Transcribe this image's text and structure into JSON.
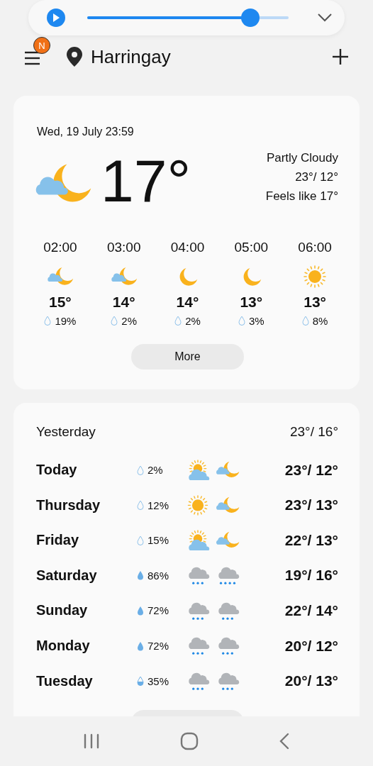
{
  "media_player": {
    "playing": false,
    "level": 0.81
  },
  "header": {
    "menu_badge": "N",
    "location": "Harringay"
  },
  "current": {
    "date": "Wed, 19 July 23:59",
    "icon": {
      "kind": "moon-cloud"
    },
    "temperature": "17°",
    "condition": "Partly Cloudy",
    "high_low": "23°/ 12°",
    "feels_like": "Feels like 17°",
    "hourly": [
      {
        "time": "02:00",
        "icon": {
          "kind": "moon-cloud"
        },
        "temperature": "15°",
        "drop": {
          "kind": "empty"
        },
        "precip": "19%"
      },
      {
        "time": "03:00",
        "icon": {
          "kind": "moon-cloud"
        },
        "temperature": "14°",
        "drop": {
          "kind": "empty"
        },
        "precip": "2%"
      },
      {
        "time": "04:00",
        "icon": {
          "kind": "moon"
        },
        "temperature": "14°",
        "drop": {
          "kind": "empty"
        },
        "precip": "2%"
      },
      {
        "time": "05:00",
        "icon": {
          "kind": "moon"
        },
        "temperature": "13°",
        "drop": {
          "kind": "empty"
        },
        "precip": "3%"
      },
      {
        "time": "06:00",
        "icon": {
          "kind": "sun"
        },
        "temperature": "13°",
        "drop": {
          "kind": "empty"
        },
        "precip": "8%"
      }
    ],
    "more_button": "More"
  },
  "daily": {
    "yesterday": {
      "label": "Yesterday",
      "high_low": "23°/ 16°"
    },
    "days": [
      {
        "day": "Today",
        "drop": {
          "kind": "empty"
        },
        "precip": "2%",
        "day_icon": {
          "kind": "sun-cloud"
        },
        "night_icon": {
          "kind": "moon-cloud"
        },
        "high_low": "23°/ 12°"
      },
      {
        "day": "Thursday",
        "drop": {
          "kind": "empty"
        },
        "precip": "12%",
        "day_icon": {
          "kind": "sun"
        },
        "night_icon": {
          "kind": "moon-cloud"
        },
        "high_low": "23°/ 13°"
      },
      {
        "day": "Friday",
        "drop": {
          "kind": "empty"
        },
        "precip": "15%",
        "day_icon": {
          "kind": "sun-cloud"
        },
        "night_icon": {
          "kind": "moon-cloud"
        },
        "high_low": "22°/ 13°"
      },
      {
        "day": "Saturday",
        "drop": {
          "kind": "full"
        },
        "precip": "86%",
        "day_icon": {
          "kind": "rain"
        },
        "night_icon": {
          "kind": "rain-heavy"
        },
        "high_low": "19°/ 16°"
      },
      {
        "day": "Sunday",
        "drop": {
          "kind": "full"
        },
        "precip": "72%",
        "day_icon": {
          "kind": "rain"
        },
        "night_icon": {
          "kind": "rain"
        },
        "high_low": "22°/ 14°"
      },
      {
        "day": "Monday",
        "drop": {
          "kind": "full"
        },
        "precip": "72%",
        "day_icon": {
          "kind": "rain"
        },
        "night_icon": {
          "kind": "rain"
        },
        "high_low": "20°/ 12°"
      },
      {
        "day": "Tuesday",
        "drop": {
          "kind": "half"
        },
        "precip": "35%",
        "day_icon": {
          "kind": "rain"
        },
        "night_icon": {
          "kind": "rain"
        },
        "high_low": "20°/ 13°"
      }
    ]
  }
}
